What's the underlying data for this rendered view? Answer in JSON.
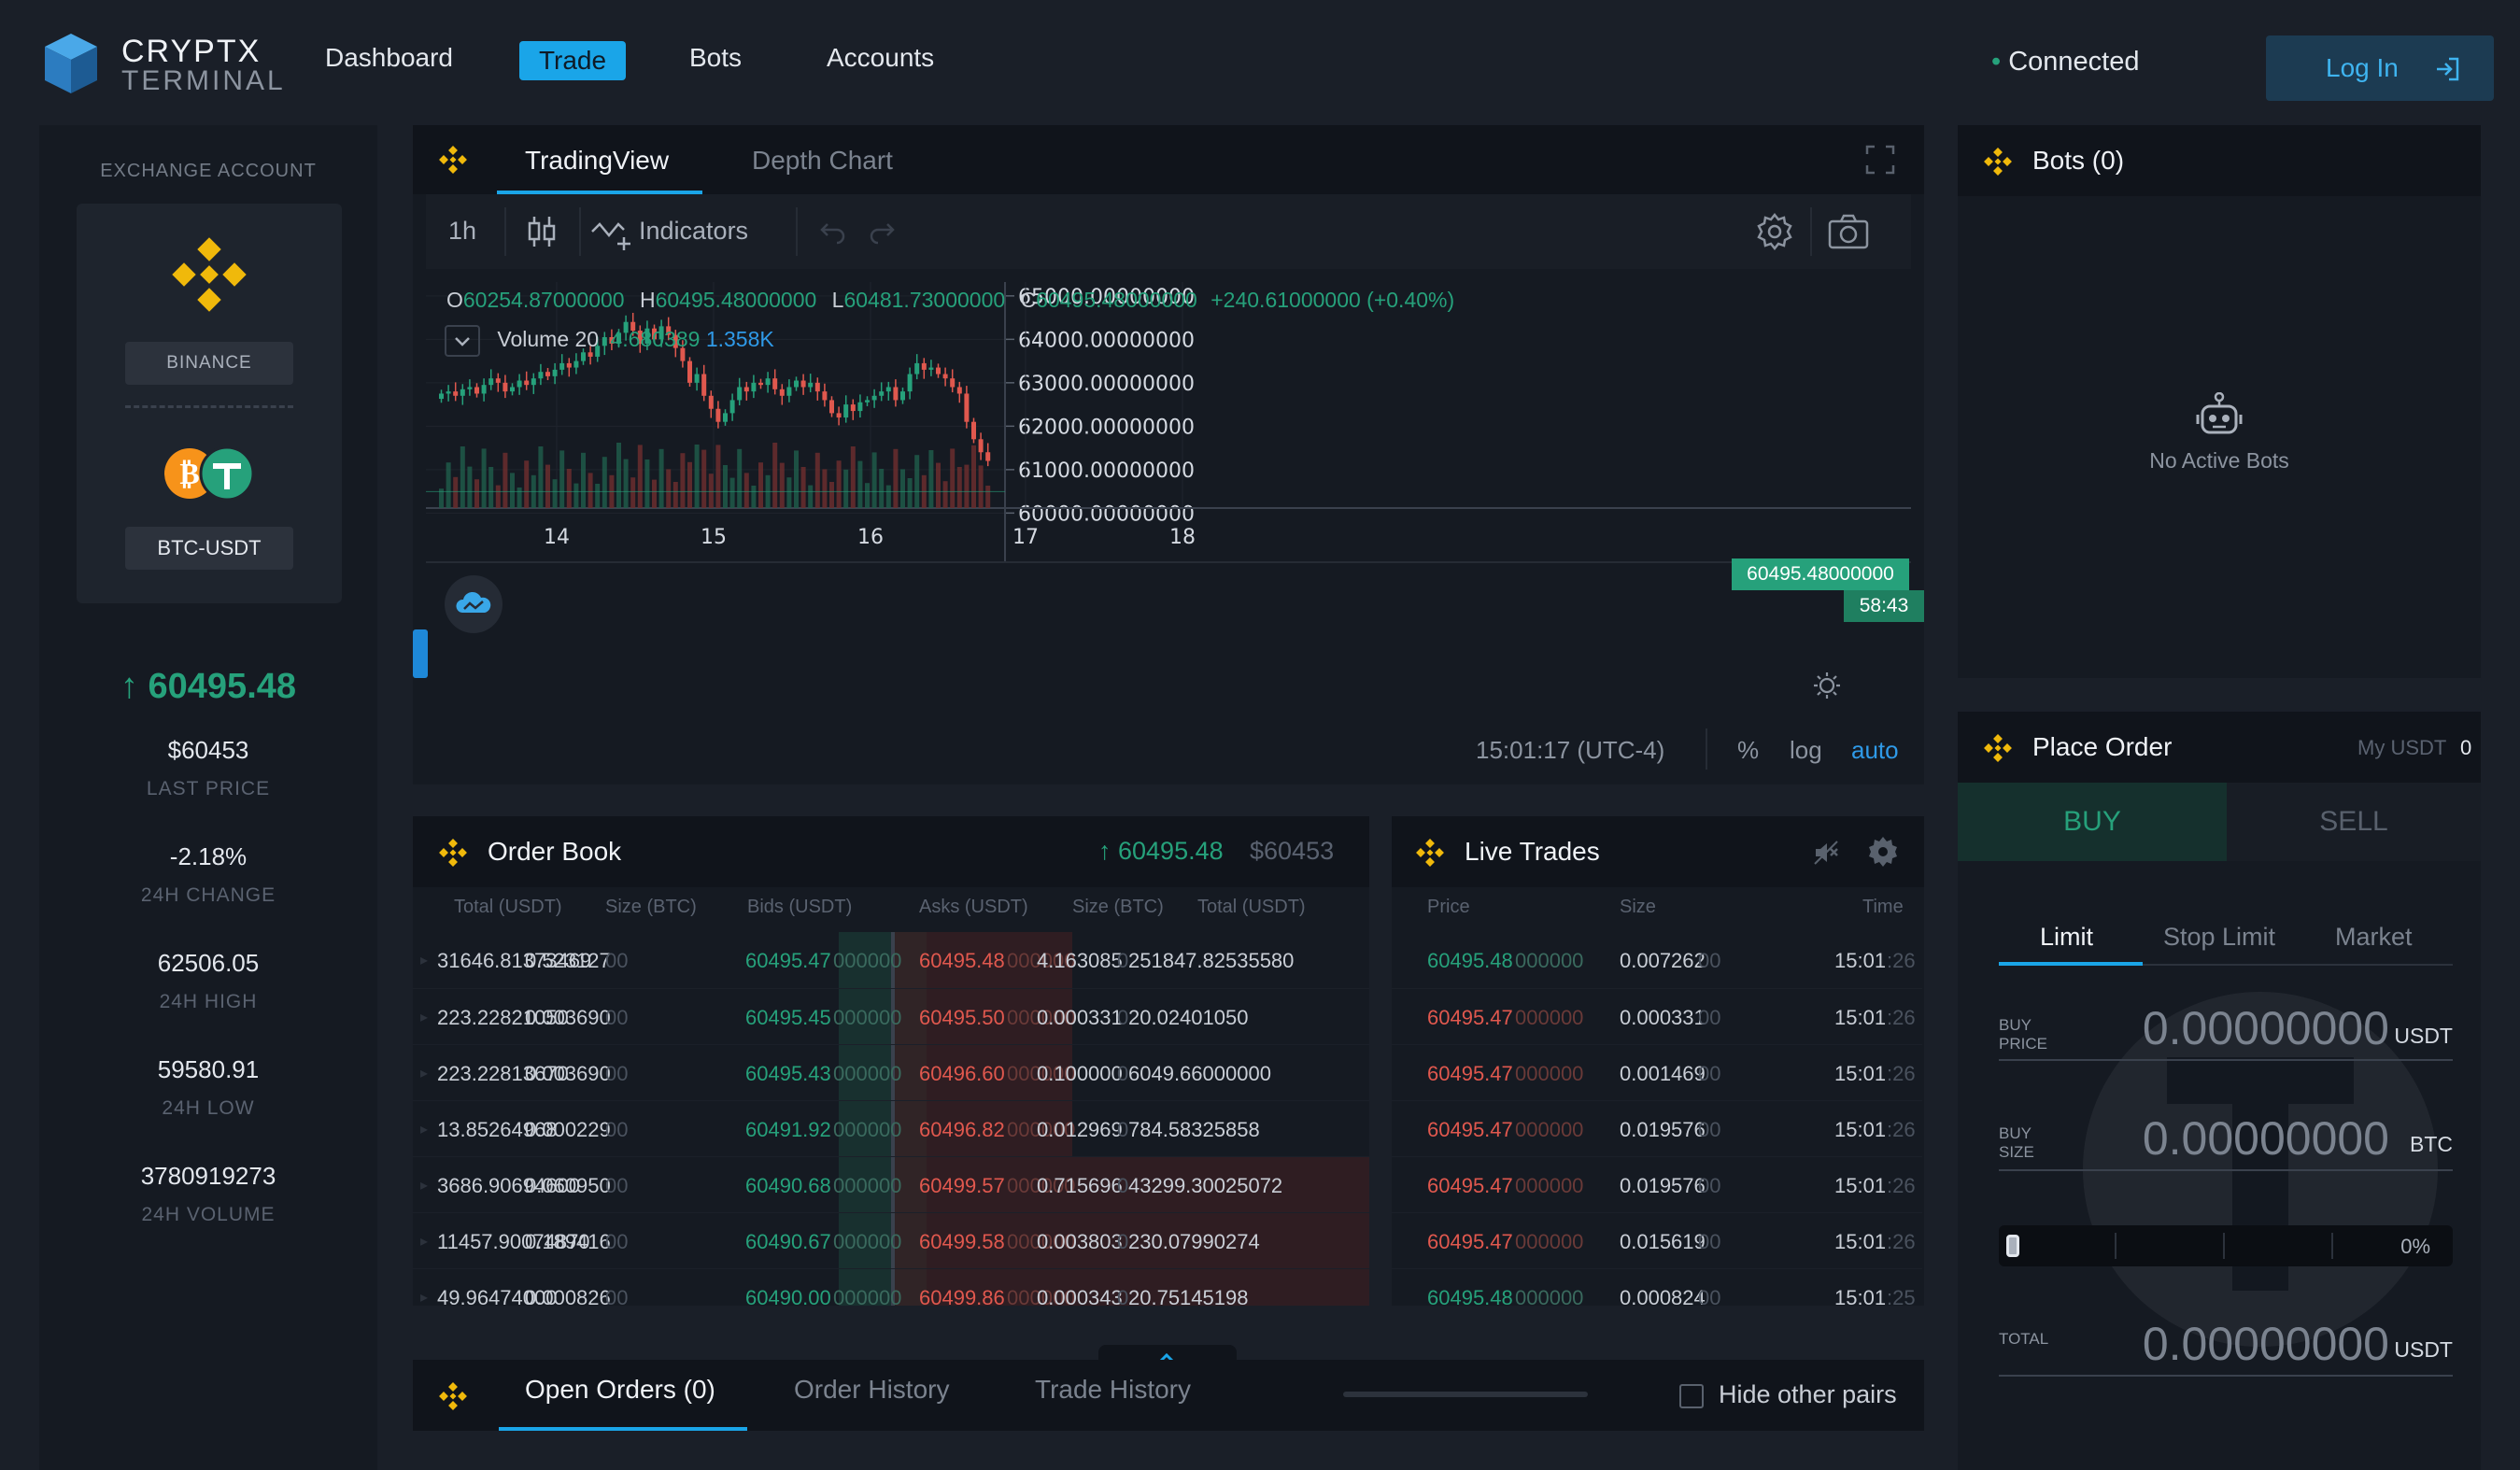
{
  "brand": {
    "name": "CRYPTX",
    "sub": "TERMINAL"
  },
  "nav": {
    "dashboard": "Dashboard",
    "trade": "Trade",
    "bots": "Bots",
    "accounts": "Accounts"
  },
  "status": {
    "dot": "•",
    "text": "Connected"
  },
  "login": {
    "label": "Log In"
  },
  "account": {
    "heading": "EXCHANGE ACCOUNT",
    "exchange": "BINANCE",
    "pair": "BTC-USDT",
    "price": "↑ 60495.48",
    "last_price": "$60453",
    "last_price_label": "LAST PRICE",
    "change": "-2.18%",
    "change_label": "24H CHANGE",
    "high": "62506.05",
    "high_label": "24H HIGH",
    "low": "59580.91",
    "low_label": "24H LOW",
    "volume": "3780919273",
    "volume_label": "24H VOLUME"
  },
  "chart_panel": {
    "tab_tv": "TradingView",
    "tab_depth": "Depth Chart",
    "interval": "1h",
    "indicators": "Indicators",
    "ohlc": {
      "o_label": "O",
      "o": "60254.87000000",
      "h_label": "H",
      "h": "60495.48000000",
      "l_label": "L",
      "l": "60481.73000000",
      "c_label": "C",
      "c": "60495.48000000",
      "chg": "+240.61000000 (+0.40%)"
    },
    "volume_label": "Volume 20",
    "volume_val1": "4.680389",
    "volume_val2": "1.358K",
    "last_price_tag": "60495.48000000",
    "countdown": "58:43",
    "clock": "15:01:17 (UTC-4)",
    "pct": "%",
    "log": "log",
    "auto": "auto"
  },
  "chart_data": {
    "type": "candlestick",
    "y_ticks": [
      "65000.00000000",
      "64000.00000000",
      "63000.00000000",
      "62000.00000000",
      "61000.00000000",
      "60000.00000000"
    ],
    "x_ticks": [
      "14",
      "15",
      "16",
      "17",
      "18"
    ],
    "ylim": [
      59500,
      65500
    ],
    "colors": {
      "up": "#26a17b",
      "down": "#e0584e"
    },
    "segments": [
      {
        "start": 0,
        "closes": [
          62750,
          62800,
          62700,
          62850,
          62900,
          62750,
          62950,
          63100,
          63000,
          62800,
          62900,
          63050,
          62950,
          63100,
          63250,
          63150,
          63300,
          63450,
          63350,
          63500,
          63700,
          63600,
          63850,
          64050,
          63900,
          64150,
          64400,
          64200,
          63900,
          64250,
          64000,
          64300,
          64100,
          63800,
          63500,
          63000,
          63200,
          62700,
          62400,
          62100,
          62300,
          62600,
          62900,
          62800,
          63000,
          62950,
          63100,
          62850,
          62700,
          62900,
          63050,
          62900,
          63000,
          62800,
          62600,
          62300,
          62200,
          62500,
          62350,
          62550,
          62600,
          62700,
          62800,
          62900,
          62600,
          62800,
          63200,
          63450,
          63300,
          63350,
          63200,
          63100,
          62900,
          62750,
          62100,
          61700,
          61400,
          61200,
          61000,
          61300
        ]
      },
      {
        "start": 96,
        "closes": [
          61200,
          61500,
          61800,
          62100,
          62300,
          62500,
          62300,
          62200,
          62000
        ]
      },
      {
        "start": 115,
        "closes": [
          60950,
          60700,
          60300,
          59800,
          59900,
          60300,
          60500
        ]
      }
    ]
  },
  "bots": {
    "title": "Bots (0)",
    "empty": "No Active Bots"
  },
  "order_book": {
    "title": "Order Book",
    "price": "↑ 60495.48",
    "last": "$60453",
    "cols": [
      "Total (USDT)",
      "Size (BTC)",
      "Bids (USDT)",
      "Asks (USDT)",
      "Size (BTC)",
      "Total (USDT)"
    ],
    "rows": [
      [
        "31646.81373469",
        "0.523127",
        "00",
        "60495.47",
        "000000",
        "60495.48",
        "000000",
        "4.163085",
        "0",
        "251847.82535580"
      ],
      [
        "223.22821050",
        "0.003690",
        "00",
        "60495.45",
        "000000",
        "60495.50",
        "000000",
        "0.000331",
        "0",
        "20.02401050"
      ],
      [
        "223.22813670",
        "0.003690",
        "00",
        "60495.43",
        "000000",
        "60496.60",
        "000000",
        "0.100000",
        "0",
        "6049.66000000"
      ],
      [
        "13.85264968",
        "0.000229",
        "00",
        "60491.92",
        "000000",
        "60496.82",
        "000000",
        "0.012969",
        "0",
        "784.58325858"
      ],
      [
        "3686.90694600",
        "0.060950",
        "00",
        "60490.68",
        "000000",
        "60499.57",
        "000000",
        "0.715696",
        "0",
        "43299.30025072"
      ],
      [
        "11457.90074870",
        "0.189416",
        "00",
        "60490.67",
        "000000",
        "60499.58",
        "000000",
        "0.003803",
        "0",
        "230.07990274"
      ],
      [
        "49.96474000",
        "0.000826",
        "00",
        "60490.00",
        "000000",
        "60499.86",
        "000000",
        "0.000343",
        "0",
        "20.75145198"
      ]
    ]
  },
  "live_trades": {
    "title": "Live Trades",
    "cols": [
      "Price",
      "Size",
      "Time"
    ],
    "rows": [
      [
        "60495.48",
        "000000",
        "0.007262",
        "00",
        "15:01",
        ":26",
        "up"
      ],
      [
        "60495.47",
        "000000",
        "0.000331",
        "00",
        "15:01",
        ":26",
        "down"
      ],
      [
        "60495.47",
        "000000",
        "0.001469",
        "00",
        "15:01",
        ":26",
        "down"
      ],
      [
        "60495.47",
        "000000",
        "0.019576",
        "00",
        "15:01",
        ":26",
        "down"
      ],
      [
        "60495.47",
        "000000",
        "0.019576",
        "00",
        "15:01",
        ":26",
        "down"
      ],
      [
        "60495.47",
        "000000",
        "0.015619",
        "00",
        "15:01",
        ":26",
        "down"
      ],
      [
        "60495.48",
        "000000",
        "0.000824",
        "00",
        "15:01",
        ":25",
        "up"
      ]
    ]
  },
  "orders": {
    "open": "Open Orders (0)",
    "history": "Order History",
    "trades": "Trade History",
    "hide": "Hide other pairs"
  },
  "place_order": {
    "title": "Place Order",
    "balance_label": "My USDT",
    "balance": "0",
    "buy": "BUY",
    "sell": "SELL",
    "types": [
      "Limit",
      "Stop Limit",
      "Market"
    ],
    "price_label1": "BUY",
    "price_label2": "PRICE",
    "price": "0.00000000",
    "price_cur": "USDT",
    "size_label1": "BUY",
    "size_label2": "SIZE",
    "size": "0.00000000",
    "size_cur": "BTC",
    "slider_pct": "0%",
    "total_label": "TOTAL",
    "total": "0.00000000",
    "total_cur": "USDT"
  }
}
